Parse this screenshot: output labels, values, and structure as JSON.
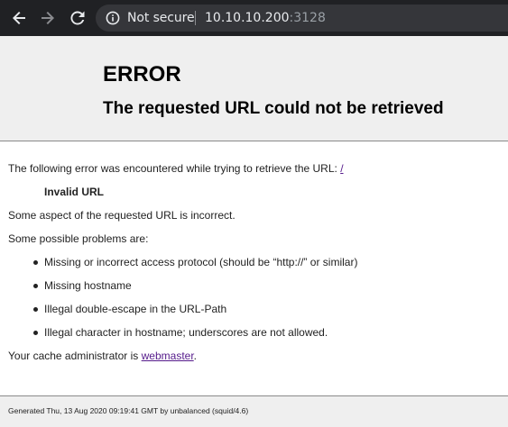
{
  "browser": {
    "back_icon": "arrow-left-icon",
    "forward_icon": "arrow-right-icon",
    "reload_icon": "reload-icon",
    "security_icon": "info-icon",
    "security_label": "Not secure",
    "url_host": "10.10.10.200",
    "url_port": ":3128",
    "colors": {
      "toolbar": "#202124",
      "omnibox": "#35363a",
      "text": "#e8eaed",
      "dim_text": "#9aa0a6"
    }
  },
  "page": {
    "title": "ERROR",
    "subtitle": "The requested URL could not be retrieved",
    "intro_text": "The following error was encountered while trying to retrieve the URL: ",
    "intro_link": "/",
    "error_name": "Invalid URL",
    "explanation": "Some aspect of the requested URL is incorrect.",
    "problems_intro": "Some possible problems are:",
    "problems": [
      "Missing or incorrect access protocol (should be “http://” or similar)",
      "Missing hostname",
      "Illegal double-escape in the URL-Path",
      "Illegal character in hostname; underscores are not allowed."
    ],
    "admin_text": "Your cache administrator is ",
    "admin_link": "webmaster",
    "admin_suffix": ".",
    "footer": "Generated Thu, 13 Aug 2020 09:19:41 GMT by unbalanced (squid/4.6)",
    "colors": {
      "header_bg": "#efefef",
      "link": "#551a8b"
    }
  }
}
